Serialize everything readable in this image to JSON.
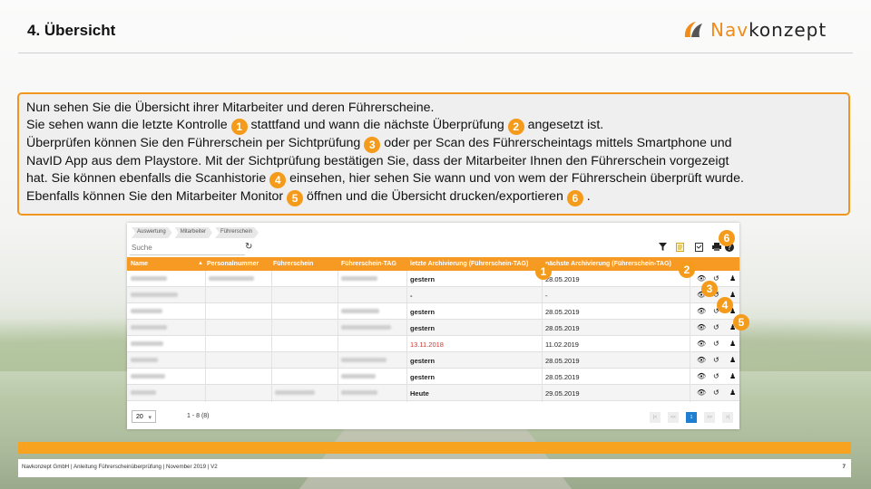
{
  "slide": {
    "title": "4. Übersicht",
    "logo_nav": "Nav",
    "logo_konzept": "konzept",
    "paragraph": [
      [
        "Nun sehen Sie die Übersicht ihrer Mitarbeiter und deren Führerscheine."
      ],
      [
        "Sie sehen wann die letzte Kontrolle ",
        {
          "n": "1"
        },
        " stattfand und wann die nächste Überprüfung ",
        {
          "n": "2"
        },
        " angesetzt ist."
      ],
      [
        "Überprüfen können Sie den Führerschein per Sichtprüfung ",
        {
          "n": "3"
        },
        "  oder per Scan des Führerscheintags mittels Smartphone und"
      ],
      [
        "NavID App aus dem Playstore. Mit der Sichtprüfung bestätigen Sie, dass der Mitarbeiter Ihnen den Führerschein vorgezeigt"
      ],
      [
        "hat. Sie können ebenfalls die Scanhistorie ",
        {
          "n": "4"
        },
        "  einsehen, hier sehen Sie wann und von wem der Führerschein überprüft wurde."
      ],
      [
        "Ebenfalls können Sie den Mitarbeiter Monitor ",
        {
          "n": "5"
        },
        " öffnen und die Übersicht drucken/exportieren ",
        {
          "n": "6"
        },
        " ."
      ]
    ],
    "footer_text": "Navkonzept GmbH  |  Anleitung Führerscheinüberprüfung  |  November 2019  |  V2",
    "page_number": "7"
  },
  "app": {
    "breadcrumbs": [
      "Auswertung",
      "Mitarbeiter",
      "Führerschein"
    ],
    "search_placeholder": "Suche",
    "columns": [
      "Name",
      "Personalnummer",
      "Führerschein",
      "Führerschein-TAG",
      "letzte Archivierung (Führerschein-TAG)",
      "nächste Archivierung (Führerschein-TAG)"
    ],
    "rows": [
      {
        "last": "gestern",
        "next": "28.05.2019",
        "last_red": false
      },
      {
        "last": "-",
        "next": "-",
        "last_red": false
      },
      {
        "last": "gestern",
        "next": "28.05.2019",
        "last_red": false
      },
      {
        "last": "gestern",
        "next": "28.05.2019",
        "last_red": false
      },
      {
        "last": "13.11.2018",
        "next": "11.02.2019",
        "last_red": true
      },
      {
        "last": "gestern",
        "next": "28.05.2019",
        "last_red": false
      },
      {
        "last": "gestern",
        "next": "28.05.2019",
        "last_red": false
      },
      {
        "last": "Heute",
        "next": "29.05.2019",
        "last_red": false
      }
    ],
    "page_size": "20",
    "page_info": "1 - 8 (8)",
    "current_page": "1",
    "markers": [
      "1",
      "2",
      "3",
      "4",
      "5",
      "6"
    ]
  },
  "colors": {
    "accent": "#f59b1c",
    "header": "#f79a24",
    "pager_active": "#1e7fd2",
    "red_date": "#d0342c"
  }
}
